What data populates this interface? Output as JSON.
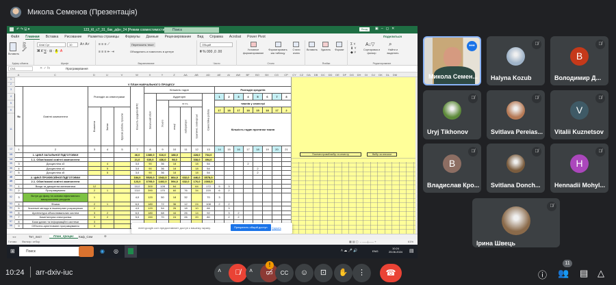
{
  "meet": {
    "presenter_title": "Микола Семенов (Презентація)",
    "time": "10:24",
    "meeting_code": "arr-dxiv-iuc",
    "participant_count": "11",
    "present_badge": "!"
  },
  "participants": [
    {
      "name": "Микола Семен...",
      "initial": "",
      "color": "#1a73e8",
      "active": true
    },
    {
      "name": "Halyna Kozub",
      "initial": "",
      "color": "#9fb3c8"
    },
    {
      "name": "Володимир Д...",
      "initial": "В",
      "color": "#c5391a"
    },
    {
      "name": "Uryj Tikhonov",
      "initial": "",
      "color": "#5d8a3a"
    },
    {
      "name": "Svitlava Pereias...",
      "initial": "",
      "color": "#b57955"
    },
    {
      "name": "Vitalii Kuznetsov",
      "initial": "V",
      "color": "#3f5a66"
    },
    {
      "name": "Владислав Кро...",
      "initial": "В",
      "color": "#8d6e63"
    },
    {
      "name": "Svitlana Donch...",
      "initial": "",
      "color": "#7a5c3e"
    },
    {
      "name": "Hennadii Mohyl...",
      "initial": "H",
      "color": "#ab47bc"
    },
    {
      "name": "Ірина Швець",
      "initial": "",
      "color": "#8a6a4a"
    }
  ],
  "excel": {
    "title": "123_КІ_с7_31_бак_дфн_24 [Режим совместимости] - Excel",
    "search": "Поиск",
    "signin": "Вход",
    "share": "Поделиться",
    "tabs": [
      "Файл",
      "Главная",
      "Вставка",
      "Рисование",
      "Разметка страницы",
      "Формулы",
      "Данные",
      "Рецензирование",
      "Вид",
      "Справка",
      "Acrobat",
      "Power Pivot"
    ],
    "ribbon": {
      "paste": "Вставить",
      "clipboard": "Буфер обмена",
      "font_name": "Arial Cyr",
      "font_size": "10",
      "font": "Шрифт",
      "wrap": "Переносить текст",
      "merge": "Объединить и поместить в центре",
      "alignment": "Выравнивание",
      "number_format": "Общий",
      "number": "Число",
      "cond_format": "Условное форматирование",
      "format_table": "Форматировать как таблицу",
      "cell_styles": "Стили ячеек",
      "styles": "Стили",
      "insert": "Вставить",
      "delete": "Удалить",
      "format": "Формат",
      "cells": "Ячейки",
      "sort": "Сортировка и фильтр",
      "find": "Найти и выделить",
      "editing": "Редактирование"
    },
    "name_box": "CV1",
    "formula": "Програмування",
    "columns": [
      "A",
      "C",
      "D",
      "U",
      "V",
      "W",
      "X",
      "Y",
      "Z",
      "AA",
      "AB",
      "AD",
      "AE",
      "AI",
      "AW",
      "BF",
      "BO",
      "BX",
      "CG",
      "CP",
      "CY",
      "CZ",
      "DA",
      "DB",
      "DC",
      "DD",
      "DE",
      "DF",
      "DG",
      "DH",
      "DI",
      "DJ",
      "DK",
      "DL",
      "DM"
    ],
    "header": {
      "plan_title": "V ПЛАН НАВЧАЛЬНОГО ПРОЦЕСУ",
      "num": "№",
      "components": "Освітні компоненти",
      "by_semester": "Розподіл за семестрами",
      "exams": "Екзамени",
      "credits_tests": "Заліки",
      "coursework": "Курсові роботи, проєкти",
      "ects": "Кількість кредитів ЄКТС",
      "hours": "Кількість годин",
      "total": "Загальний обсяг",
      "auditory": "Аудиторні",
      "all": "Усього",
      "incl": "в т.ч.",
      "lectures": "лекції",
      "labs": "лабораторні",
      "practical": "практичні, семінарські",
      "self": "Самостійна робота",
      "credit_dist": "Розподіл кредитів",
      "sem_nums": [
        "1",
        "2",
        "3",
        "4",
        "5",
        "6",
        "7",
        "8"
      ],
      "weeks_label": "тижнів у семестрі",
      "weeks": [
        "17",
        "18",
        "17",
        "18",
        "15",
        "18",
        "17",
        "2"
      ],
      "weekly_hours": "Кількість годин протягом тижня",
      "col_nums": [
        "1",
        "2",
        "3",
        "4",
        "5",
        "7",
        "8",
        "9",
        "10",
        "11",
        "12",
        "13",
        "14",
        "15",
        "16",
        "17",
        "18",
        "19",
        "20",
        "21"
      ],
      "elective_sem": "Посеместровий вибір та семестр",
      "elective_list": "Вибір за списком"
    },
    "rows": [
      {
        "rn": "13",
        "t": "sec",
        "c": [
          "",
          "1. ЦИКЛ ЗАГАЛЬНОЇ ПІДГОТОВКИ",
          "",
          "",
          "",
          "46,0",
          "1380,0",
          "616,0",
          "188,0",
          "",
          "428,0",
          "764,0",
          "",
          "",
          "",
          "",
          "",
          "",
          "",
          ""
        ]
      },
      {
        "rn": "14",
        "t": "sec",
        "c": [
          "",
          "1.1. Обов'язкові освітні компоненти",
          "",
          "",
          "",
          "21,0",
          "630,0",
          "436,0",
          "98,0",
          "",
          "338,0",
          "494,0",
          "",
          "",
          "",
          "",
          "",
          "",
          "",
          ""
        ]
      },
      {
        "rn": "35",
        "t": "n",
        "c": [
          "3",
          "Дисципліна з3",
          "",
          "4",
          "",
          "3,0",
          "90",
          "36",
          "18",
          "",
          "18",
          "54",
          "",
          "",
          "",
          "2",
          "",
          "",
          "",
          ""
        ]
      },
      {
        "rn": "36",
        "t": "n",
        "c": [
          "4",
          "Дисципліна з4",
          "",
          "5",
          "",
          "3,0",
          "90",
          "36",
          "18",
          "",
          "18",
          "54",
          "",
          "",
          "",
          "",
          "2",
          "",
          "",
          ""
        ]
      },
      {
        "rn": "37",
        "t": "n",
        "c": [
          "5",
          "Дисципліна з5",
          "",
          "5",
          "",
          "3,0",
          "90",
          "36",
          "18",
          "",
          "18",
          "54",
          "",
          "",
          "",
          "",
          "2",
          "",
          "",
          ""
        ]
      },
      {
        "rn": "48",
        "t": "sec",
        "c": [
          "",
          "2. ЦИКЛ ПРОФЕСІЙНОЇ ПІДГОТОВКИ",
          "",
          "",
          "",
          "184,0",
          "5520,0",
          "1942,0",
          "864,0",
          "632,0",
          "446,0",
          "3578,0",
          "",
          "",
          "",
          "",
          "",
          "",
          "",
          ""
        ]
      },
      {
        "rn": "49",
        "t": "sec",
        "c": [
          "",
          "2.1. Обов'язкові освітні компоненти",
          "",
          "",
          "",
          "123,0",
          "3705,0",
          "1402,0",
          "594,0",
          "632,0",
          "176,0",
          "2303,0",
          "",
          "",
          "",
          "",
          "",
          "",
          "",
          ""
        ]
      },
      {
        "rn": "50",
        "t": "n",
        "c": [
          "1",
          "Вища та дискретна математика",
          "12",
          "",
          "",
          "10,0",
          "300",
          "128",
          "64",
          "",
          "64",
          "172",
          "5",
          "3",
          "",
          "",
          "",
          "",
          "",
          ""
        ]
      },
      {
        "rn": "51",
        "t": "n",
        "c": [
          "2",
          "Програмування",
          "2",
          "1",
          "",
          "13,0",
          "390",
          "170",
          "60",
          "76",
          "34",
          "220",
          "6",
          "2",
          "",
          "",
          "",
          "",
          "",
          ""
        ]
      },
      {
        "rn": "52",
        "t": "g",
        "c": [
          "3",
          "Вступ до фаху та основи ефективного використання ресурсів",
          "1",
          "",
          "",
          "4,0",
          "120",
          "50",
          "18",
          "32",
          "",
          "70",
          "3",
          "",
          "",
          "",
          "",
          "",
          "",
          ""
        ]
      },
      {
        "rn": "53",
        "t": "n",
        "c": [
          "4",
          "Фізика",
          "2",
          "1",
          "",
          "6,0",
          "180",
          "72",
          "36",
          "12",
          "24",
          "108",
          "2",
          "2",
          "",
          "",
          "",
          "",
          "",
          ""
        ]
      },
      {
        "rn": "54",
        "t": "n",
        "c": [
          "5",
          "Чисельні методи в інженерних розрахунках",
          "2",
          "",
          "",
          "4,0",
          "120",
          "54",
          "26",
          "18",
          "10",
          "66",
          "",
          "3",
          "",
          "",
          "",
          "",
          "",
          ""
        ]
      },
      {
        "rn": "55",
        "t": "n",
        "c": [
          "6",
          "Архітектура обчислювальних систем",
          "3",
          "2",
          "",
          "6,0",
          "180",
          "68",
          "44",
          "26",
          "14",
          "92",
          "",
          "3",
          "2",
          "",
          "",
          "",
          "",
          ""
        ]
      },
      {
        "rn": "56",
        "t": "n",
        "c": [
          "7",
          "Комп'ютерна електроніка",
          "3",
          "2",
          "",
          "5,0",
          "150",
          "70",
          "24",
          "26",
          "20",
          "80",
          "",
          "2",
          "2",
          "",
          "",
          "",
          "",
          ""
        ]
      },
      {
        "rn": "57",
        "t": "n",
        "c": [
          "8",
          "Бази даних та інформаційні системи",
          "3",
          "",
          "",
          "",
          "",
          "",
          "",
          "",
          "",
          "",
          "",
          "",
          "",
          "",
          "",
          "",
          "",
          ""
        ]
      },
      {
        "rn": "58",
        "t": "n",
        "c": [
          "9",
          "Об'єктно-орієнтоване програмування",
          "3",
          "",
          "",
          "",
          "",
          "",
          "",
          "",
          "",
          "",
          "",
          "",
          "",
          "",
          "",
          "",
          "",
          ""
        ]
      }
    ],
    "sheets": [
      "Тит_лист",
      "План_процес",
      "Каф_Сем"
    ],
    "status": {
      "ready": "Готово",
      "filter": "Фильтр: отбор",
      "zoom": "61%"
    },
    "share_note": {
      "text": "meet.google.com предоставляет доступ к вашему экрану.",
      "stop": "Прекратить общий доступ",
      "hide": "Скрыть"
    },
    "taskbar": {
      "search": "Поиск",
      "lang": "ENG",
      "time": "10:24",
      "date": "25.06.2024"
    }
  }
}
